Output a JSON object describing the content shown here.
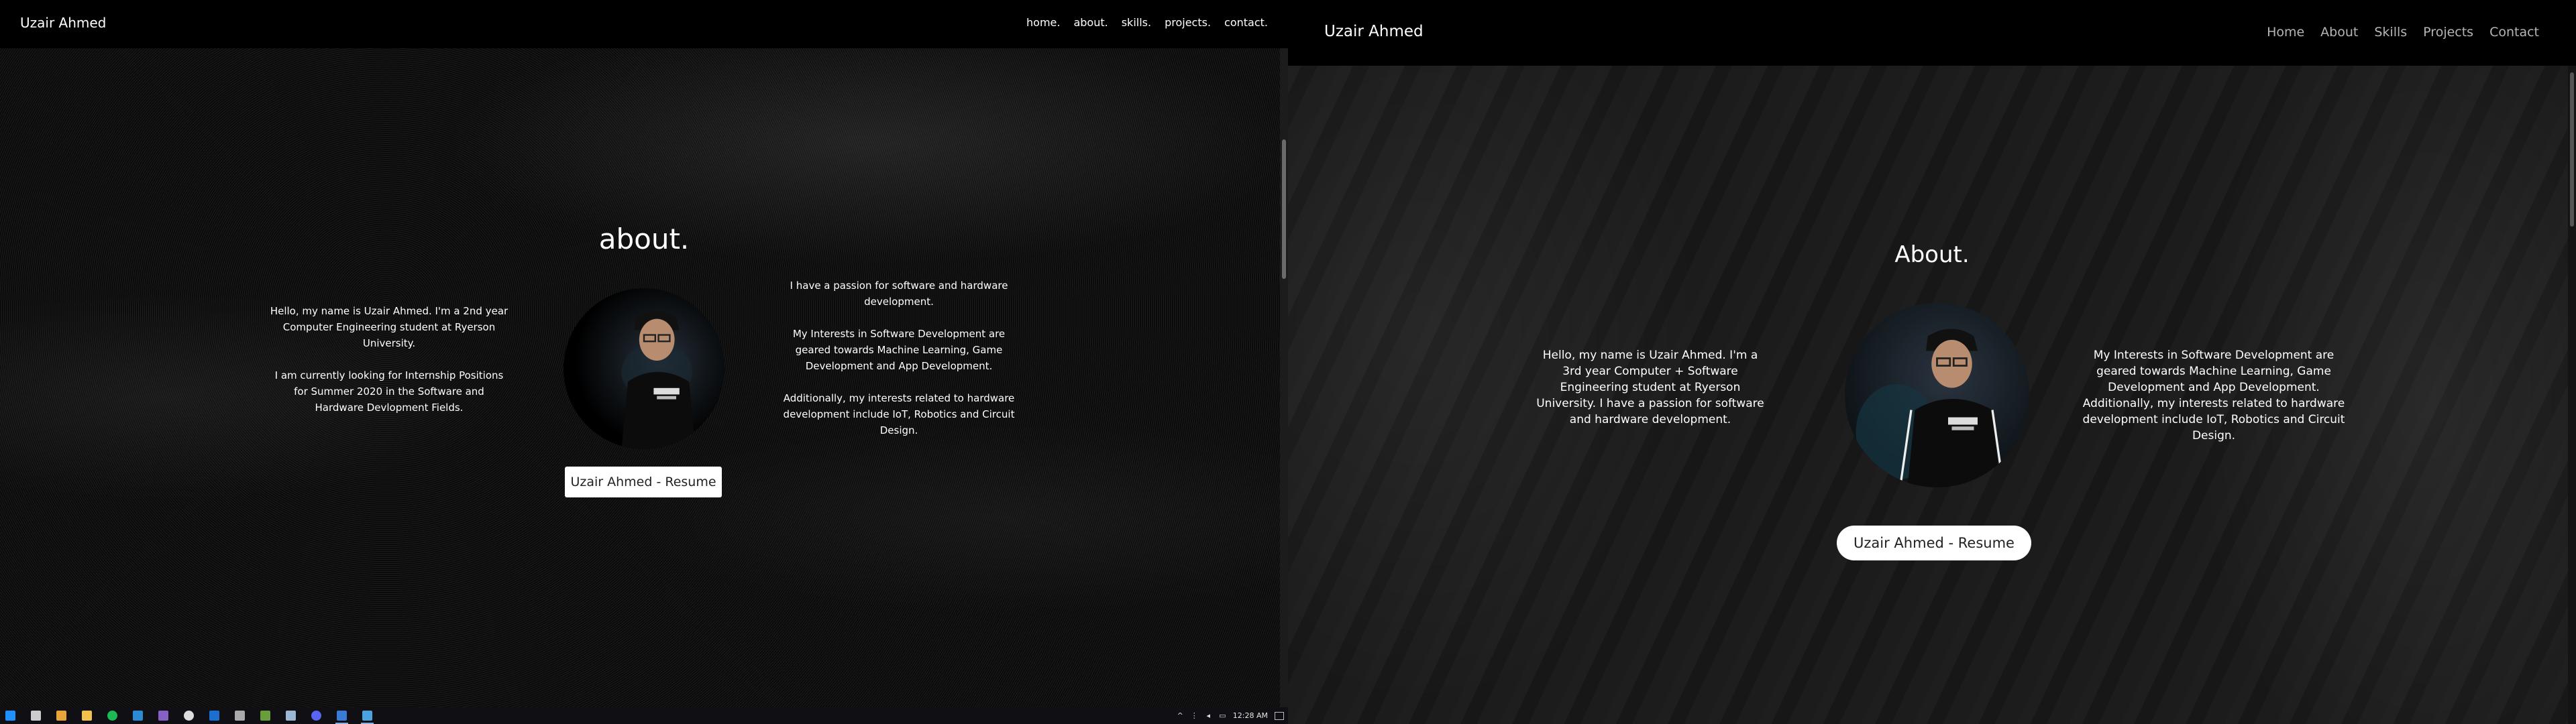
{
  "left": {
    "brand": "Uzair Ahmed",
    "nav": [
      "home.",
      "about.",
      "skills.",
      "projects.",
      "contact."
    ],
    "title": "about.",
    "col_left": [
      "Hello, my name is Uzair Ahmed. I'm a 2nd year Computer Engineering student at Ryerson University.",
      "I am currently looking for Internship Positions for Summer 2020 in the Software and Hardware Devlopment Fields."
    ],
    "col_right": [
      "I have a passion for software and hardware development.",
      "My Interests in Software Development are geared towards Machine Learning, Game Development and App Development.",
      "Additionally, my interests related to hardware development include IoT, Robotics and Circuit Design."
    ],
    "resume_label": "Uzair Ahmed - Resume"
  },
  "right": {
    "brand": "Uzair Ahmed",
    "nav": [
      "Home",
      "About",
      "Skills",
      "Projects",
      "Contact"
    ],
    "title": "About.",
    "col_left": "Hello, my name is Uzair Ahmed. I'm a 3rd year Computer + Software Engineering student at Ryerson University. I have a passion for software and hardware development.",
    "col_right": "My Interests in Software Development are geared towards Machine Learning, Game Development and App Development. Additionally, my interests related to hardware development include IoT, Robotics and Circuit Design.",
    "resume_label": "Uzair Ahmed - Resume"
  },
  "taskbar": {
    "clock": "12:28 AM",
    "apps": [
      {
        "name": "start-icon",
        "color": "#1e90ff"
      },
      {
        "name": "task-view-icon",
        "color": "#cccccc"
      },
      {
        "name": "chrome-icon",
        "color": "#e8a33a"
      },
      {
        "name": "file-explorer-icon",
        "color": "#f2c14e"
      },
      {
        "name": "spotify-icon",
        "color": "#1db954"
      },
      {
        "name": "vscode-icon",
        "color": "#2a8ad4"
      },
      {
        "name": "visual-studio-icon",
        "color": "#8661c5"
      },
      {
        "name": "github-icon",
        "color": "#dddddd"
      },
      {
        "name": "outlook-icon",
        "color": "#1a6fd1"
      },
      {
        "name": "terminal-icon",
        "color": "#aaaaaa"
      },
      {
        "name": "minecraft-icon",
        "color": "#6a9e3a"
      },
      {
        "name": "steam-icon",
        "color": "#9bb7d4"
      },
      {
        "name": "discord-icon",
        "color": "#5865f2"
      },
      {
        "name": "app-icon",
        "color": "#3a7bd5"
      },
      {
        "name": "browser-app-icon",
        "color": "#4aa3df"
      }
    ]
  }
}
